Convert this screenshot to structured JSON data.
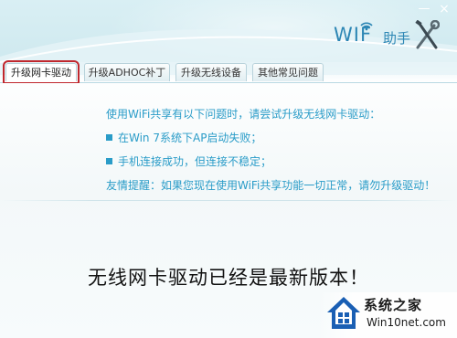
{
  "window": {
    "logo_text": "WIF",
    "logo_sub": "助手",
    "minimize_glyph": "—",
    "close_glyph": "×"
  },
  "tabs": [
    {
      "label": "升级网卡驱动",
      "active": true
    },
    {
      "label": "升级ADHOC补丁",
      "active": false
    },
    {
      "label": "升级无线设备",
      "active": false
    },
    {
      "label": "其他常见问题",
      "active": false
    }
  ],
  "content": {
    "intro": "使用WiFi共享有以下问题时，请尝试升级无线网卡驱动：",
    "issues": [
      "在Win 7系统下AP启动失败；",
      "手机连接成功，但连接不稳定；"
    ],
    "tip": "友情提醒：如果您现在使用WiFi共享功能一切正常，请勿升级驱动！",
    "status_message": "无线网卡驱动已经是最新版本！"
  },
  "watermark": {
    "title": "系统之家",
    "url": "Win10net.com"
  },
  "colors": {
    "accent_text": "#2a9cc8",
    "logo": "#2c86b4",
    "active_tab_highlight": "#c0272d"
  }
}
